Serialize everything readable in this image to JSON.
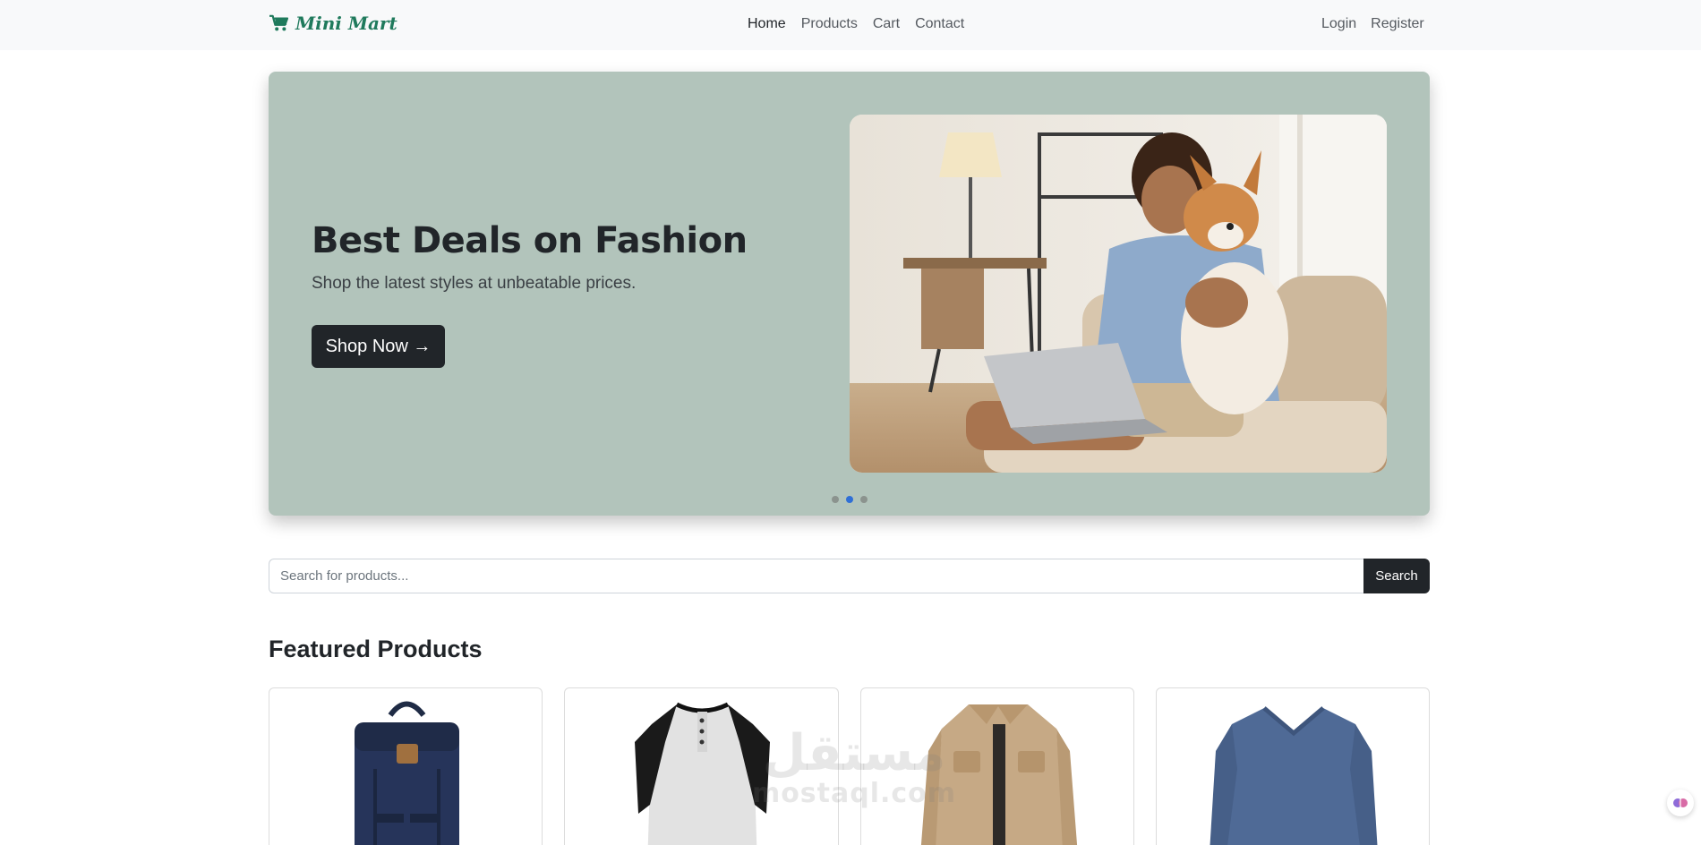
{
  "navbar": {
    "brand": "Mini Mart",
    "links": [
      "Home",
      "Products",
      "Cart",
      "Contact"
    ],
    "active_link": "Home",
    "auth": [
      "Login",
      "Register"
    ]
  },
  "hero": {
    "title": "Best Deals on Fashion",
    "subtitle": "Shop the latest styles at unbeatable prices.",
    "cta": "Shop Now →",
    "slide_count": 3,
    "active_slide": 2,
    "background": "#b2c4bb"
  },
  "search": {
    "placeholder": "Search for products...",
    "button": "Search"
  },
  "featured": {
    "title": "Featured Products",
    "items": [
      {
        "image": "navy-backpack"
      },
      {
        "image": "raglan-henley-shirt"
      },
      {
        "image": "khaki-field-jacket"
      },
      {
        "image": "blue-v-neck-sweater"
      }
    ]
  },
  "watermark": {
    "arabic": "مستقل",
    "latin": "mostaql.com"
  },
  "colors": {
    "brand": "#1f7a5c",
    "dark": "#212529",
    "navbar_bg": "#f8f9fa",
    "dot_active": "#2f6fd6"
  }
}
